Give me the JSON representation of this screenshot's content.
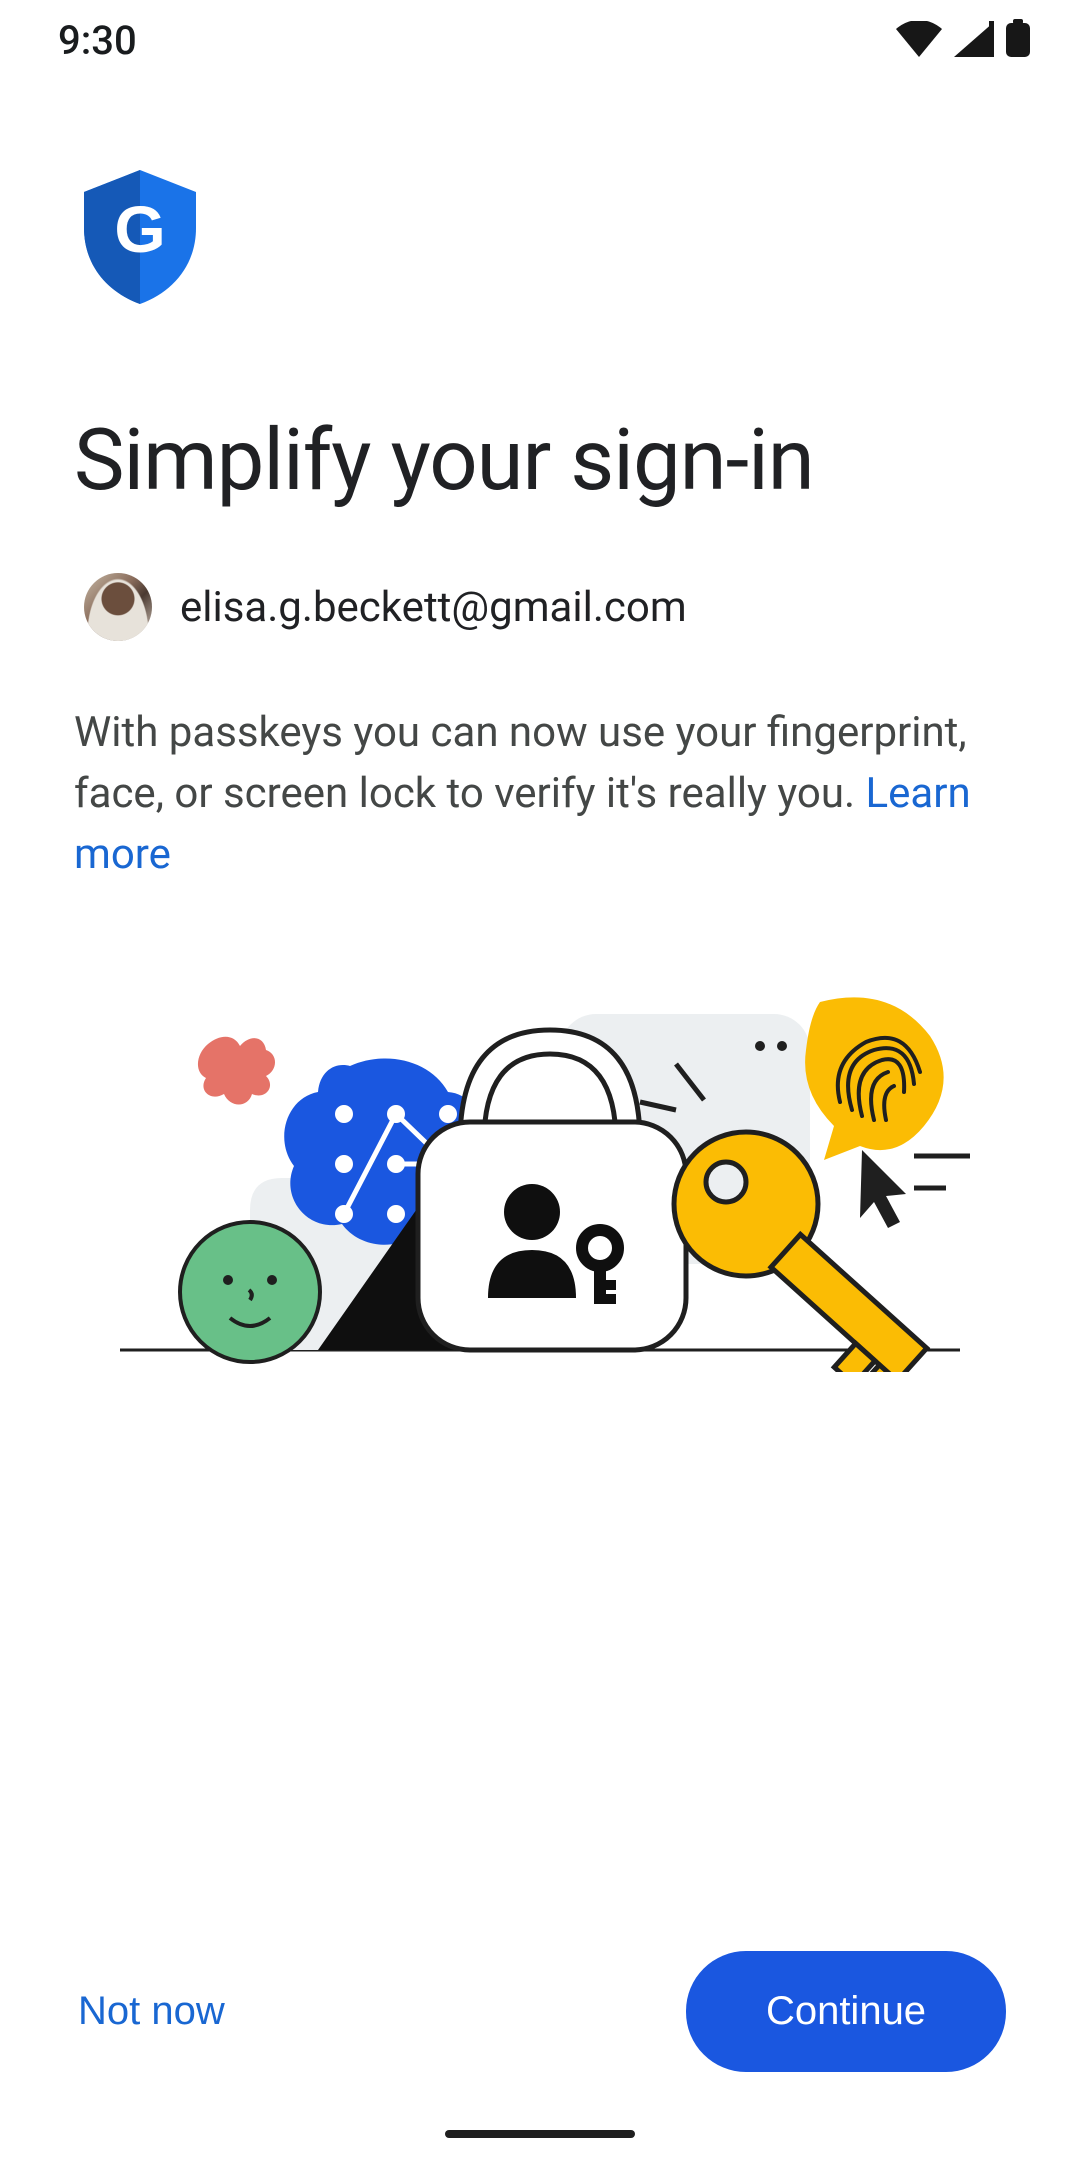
{
  "status": {
    "time": "9:30"
  },
  "header": {
    "title": "Simplify your sign-in"
  },
  "account": {
    "email": "elisa.g.beckett@gmail.com"
  },
  "body": {
    "description": "With passkeys you can now use your fingerprint, face, or screen lock to verify it's really you. ",
    "learn_more": "Learn more"
  },
  "actions": {
    "not_now": "Not now",
    "continue": "Continue"
  },
  "colors": {
    "accent_blue": "#1a57e0",
    "link_blue": "#1967d2",
    "amber": "#fbbc04",
    "green": "#57bb8a",
    "red": "#e57368"
  }
}
